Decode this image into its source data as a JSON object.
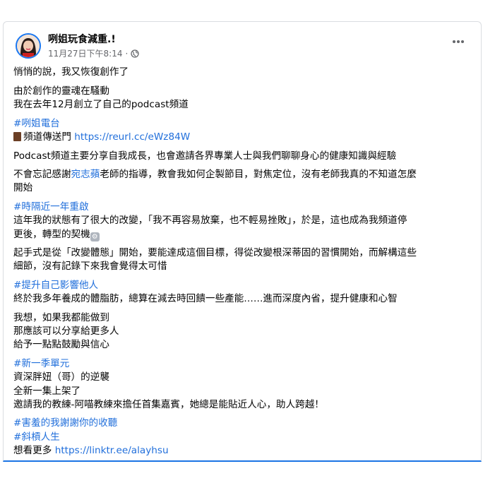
{
  "post": {
    "author": "咧姐玩食減重.!",
    "timestamp": "11月27日下午8:14",
    "separator": "·",
    "privacy_icon": "globe-icon",
    "menu_icon": "more-horizontal-icon",
    "lines": {
      "l1": "悄悄的說，我又恢復創作了",
      "l2": "由於創作的靈魂在騷動",
      "l3": "我在去年12月創立了自己的podcast頻道",
      "l4": "#咧姐電台",
      "l5_text": "頻道傳送門",
      "l5_link": "https://reurl.cc/eWz84W",
      "l6": "Podcast頻道主要分享自我成長，也會邀請各界專業人士與我們聊聊身心的健康知識與經驗",
      "l7_a": "不會忘記感謝",
      "l7_link": "宛志蘋",
      "l7_b": "老師的指導，教會我如何企製節目，對焦定位，沒有老師我真的不知道怎麼",
      "l7_c": "開始",
      "l8": "#時隔近一年重啟",
      "l9": "這年我的狀態有了很大的改變，「我不再容易放棄，也不輕易挫敗」，於是，這也成為我頻道停",
      "l10": "更後，轉型的契機",
      "l11": "起手式是從「改變體態」開始，要能達成這個目標，得從改變根深蒂固的習慣開始，而解構這些",
      "l12": "細節，沒有記錄下來我會覺得太可惜",
      "l13": "#提升自己影響他人",
      "l14": "終於我多年養成的體脂肪，總算在減去時回饋一些產能……進而深度內省，提升健康和心智",
      "l15": "我想，如果我都能做到",
      "l16": "那應該可以分享給更多人",
      "l17": "給予一點點鼓勵與信心",
      "l18": "#新一季單元",
      "l19": "資深胖妞（哥）的逆襲",
      "l20": "全新一集上架了",
      "l21": "邀請我的教練-阿喵教練來擔任首集嘉賓，她總是能貼近人心，助人跨越！",
      "l22": "#害羞的我謝謝你的收聽",
      "l23": "#斜槓人生",
      "l24_text": "想看更多",
      "l24_link": "https://linktr.ee/alayhsu"
    }
  },
  "colors": {
    "link": "#216fdb",
    "text": "#050505",
    "meta": "#65676b"
  }
}
